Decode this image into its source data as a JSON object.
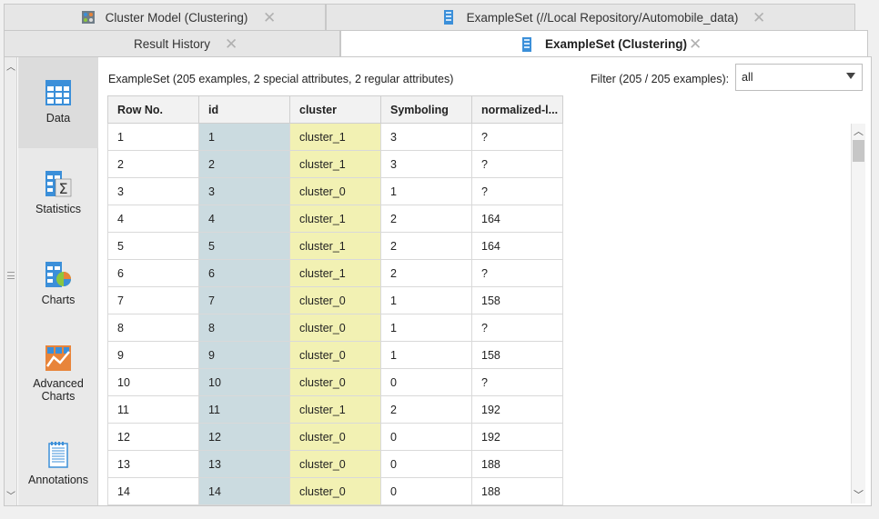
{
  "tabs_top": [
    {
      "label": "Cluster Model (Clustering)",
      "icon": "cluster-model-icon"
    },
    {
      "label": "ExampleSet (//Local Repository/Automobile_data)",
      "icon": "exampleset-icon"
    }
  ],
  "tabs_second": [
    {
      "label": "Result History"
    },
    {
      "label": "ExampleSet (Clustering)",
      "icon": "exampleset-icon",
      "active": true
    }
  ],
  "close_glyph": "✕",
  "sidebar": {
    "items": [
      {
        "label": "Data",
        "icon": "data-table-icon",
        "active": true
      },
      {
        "label": "Statistics",
        "icon": "statistics-icon"
      },
      {
        "label": "Charts",
        "icon": "charts-icon"
      },
      {
        "label": "Advanced Charts",
        "label_line1": "Advanced",
        "label_line2": "Charts",
        "icon": "advanced-charts-icon"
      },
      {
        "label": "Annotations",
        "icon": "annotations-icon"
      }
    ]
  },
  "summary": "ExampleSet (205 examples, 2 special attributes, 2 regular attributes)",
  "filter": {
    "label": "Filter (205 / 205 examples):",
    "value": "all"
  },
  "table": {
    "columns": [
      "Row No.",
      "id",
      "cluster",
      "Symboling",
      "normalized-l..."
    ],
    "rows": [
      [
        "1",
        "1",
        "cluster_1",
        "3",
        "?"
      ],
      [
        "2",
        "2",
        "cluster_1",
        "3",
        "?"
      ],
      [
        "3",
        "3",
        "cluster_0",
        "1",
        "?"
      ],
      [
        "4",
        "4",
        "cluster_1",
        "2",
        "164"
      ],
      [
        "5",
        "5",
        "cluster_1",
        "2",
        "164"
      ],
      [
        "6",
        "6",
        "cluster_1",
        "2",
        "?"
      ],
      [
        "7",
        "7",
        "cluster_0",
        "1",
        "158"
      ],
      [
        "8",
        "8",
        "cluster_0",
        "1",
        "?"
      ],
      [
        "9",
        "9",
        "cluster_0",
        "1",
        "158"
      ],
      [
        "10",
        "10",
        "cluster_0",
        "0",
        "?"
      ],
      [
        "11",
        "11",
        "cluster_1",
        "2",
        "192"
      ],
      [
        "12",
        "12",
        "cluster_0",
        "0",
        "192"
      ],
      [
        "13",
        "13",
        "cluster_0",
        "0",
        "188"
      ],
      [
        "14",
        "14",
        "cluster_0",
        "0",
        "188"
      ]
    ]
  },
  "colors": {
    "id_column": "#cbdbe0",
    "cluster_column": "#f2f1b3",
    "icon_blue": "#3b8fd9",
    "icon_orange": "#e8843a"
  }
}
